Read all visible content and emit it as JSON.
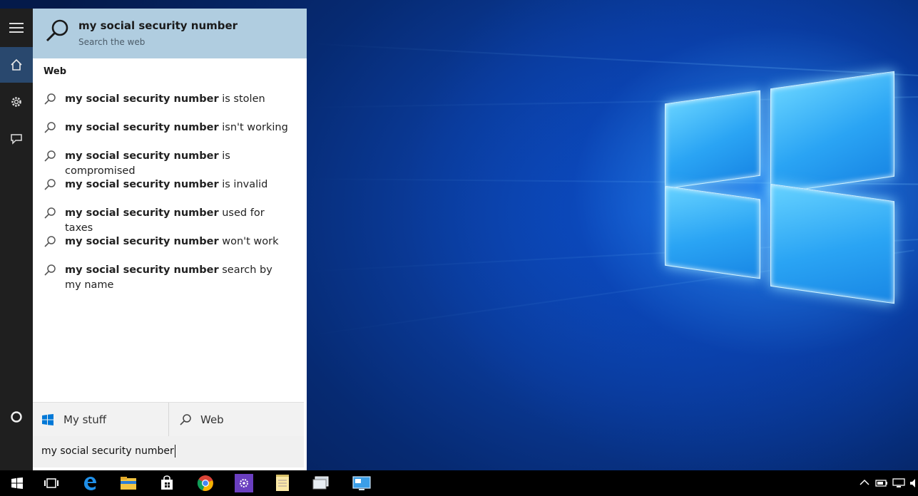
{
  "search": {
    "query": "my social security number",
    "top_result": {
      "title": "my social security number",
      "subtitle": "Search the web"
    },
    "section_heading": "Web",
    "suggestions": [
      {
        "bold": "my social security number",
        "rest": " is stolen"
      },
      {
        "bold": "my social security number",
        "rest": " isn't working"
      },
      {
        "bold": "my social security number",
        "rest": " is compromised"
      },
      {
        "bold": "my social security number",
        "rest": " is invalid"
      },
      {
        "bold": "my social security number",
        "rest": " used for taxes"
      },
      {
        "bold": "my social security number",
        "rest": " won't work"
      },
      {
        "bold": "my social security number",
        "rest": " search by my name"
      }
    ],
    "tabs": {
      "my_stuff": "My stuff",
      "web": "Web"
    }
  },
  "rail": {
    "items": [
      "menu-icon",
      "home-icon",
      "settings-icon",
      "feedback-icon",
      "cortana-circle-icon"
    ],
    "active": "home-icon"
  },
  "taskbar": {
    "items": [
      "windows-logo-icon",
      "task-view-icon",
      "edge-icon",
      "file-explorer-icon",
      "store-icon",
      "chrome-icon",
      "visual-studio-icon",
      "notepad-icon",
      "media-icon",
      "remote-desktop-icon"
    ]
  },
  "colors": {
    "top_result_bg": "#b0cde0",
    "rail_bg": "#1f1f1f",
    "rail_active": "#29486e",
    "accent": "#0078d7"
  }
}
